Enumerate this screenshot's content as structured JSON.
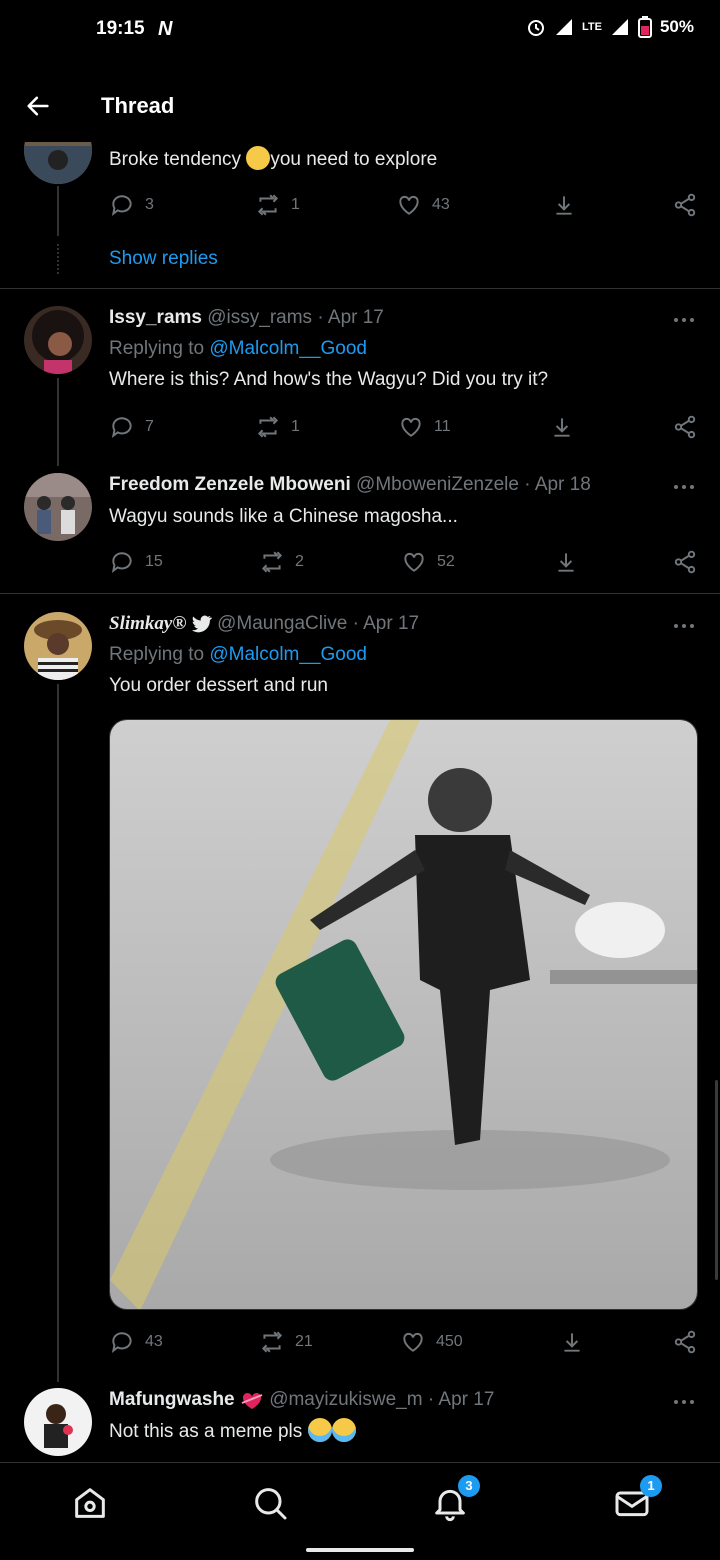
{
  "status": {
    "time": "19:15",
    "carrier_glyph": "N",
    "network": "LTE",
    "battery": "50%"
  },
  "header": {
    "title": "Thread"
  },
  "tweets": [
    {
      "text_before": "Broke tendency",
      "text_after": "you need to explore",
      "replies": "3",
      "retweets": "1",
      "likes": "43",
      "show_replies": "Show replies"
    },
    {
      "name": "Issy_rams",
      "handle": "@issy_rams",
      "date": "Apr 17",
      "replying_label": "Replying to",
      "replying_to": "@Malcolm__Good",
      "text": "Where is this? And how's the Wagyu? Did you try it?",
      "replies": "7",
      "retweets": "1",
      "likes": "11"
    },
    {
      "name": "Freedom Zenzele Mboweni",
      "handle": "@MboweniZenzele",
      "date": "Apr 18",
      "text": "Wagyu sounds like a Chinese magosha...",
      "replies": "15",
      "retweets": "2",
      "likes": "52"
    },
    {
      "name": "Slimkay®",
      "handle": "@MaungaClive",
      "date": "Apr 17",
      "replying_label": "Replying to",
      "replying_to": "@Malcolm__Good",
      "text": "You order dessert and run",
      "replies": "43",
      "retweets": "21",
      "likes": "450"
    },
    {
      "name": "Mafungwashe",
      "handle": "@mayizukiswe_m",
      "date": "Apr 17",
      "text": "Not this as a meme pls"
    }
  ],
  "nav": {
    "notifications_badge": "3",
    "messages_badge": "1"
  },
  "colors": {
    "accent": "#1d9bf0",
    "muted": "#71767b",
    "divider": "#2f3336"
  }
}
